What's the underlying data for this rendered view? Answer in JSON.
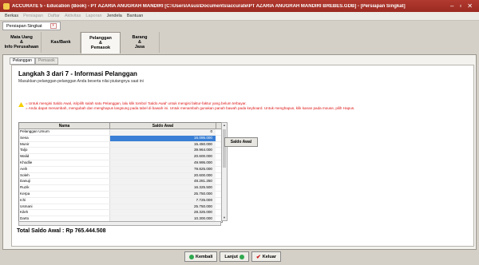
{
  "window": {
    "title": "ACCURATE 5 - Education (Book) - PT AZARIA ANUGRAH MANDIRI [C:\\Users\\Asus\\Documents\\accurate\\PT AZARIA ANUGRAH MANDIRI BREBES.GDB] - [Persiapan Singkat]",
    "minimize": "–",
    "restore": "▫",
    "close": "✕"
  },
  "menu": [
    "Berkas",
    "Persiapan",
    "Daftar",
    "Aktivitas",
    "Laporan",
    "Jendela",
    "Bantuan"
  ],
  "doc_tab": "Persiapan Singkat",
  "steps": [
    {
      "line1": "Mata Uang",
      "line2": "&",
      "line3": "Info Perusahaan"
    },
    {
      "line1": "Kas/Bank",
      "line2": "",
      "line3": ""
    },
    {
      "line1": "Pelanggan",
      "line2": "&",
      "line3": "Pemasok"
    },
    {
      "line1": "Barang",
      "line2": "&",
      "line3": "Jasa"
    }
  ],
  "subtabs": [
    "Pelanggan",
    "Pemasok"
  ],
  "heading": "Langkah 3 dari 7   - Informasi Pelanggan",
  "description": "Masukkan pelanggan-pelanggan Anda beserta nilai piutangnya saat ini",
  "warning": "= Untuk mengisi Saldo Awal, isi/pilih salah satu Pelanggan, lalu klik tombol 'Saldo Awal' untuk mengisi faktur-faktur yang belum terbayar.\n= Anda dapat menambah, mengubah dan menghapus langsung pada tabel di bawah ini. Untuk menambah gunakan panah bawah pada keyboard. Untuk menghapus, klik kanan pada mouse, pilih Hapus.",
  "grid": {
    "columns": [
      "Nama",
      "Saldo Awal"
    ],
    "rows": [
      {
        "name": "Pelanggan Umum",
        "value": "0"
      },
      {
        "name": "Sena",
        "value": "16.095.000"
      },
      {
        "name": "Munir",
        "value": "15.450.000"
      },
      {
        "name": "Taljo",
        "value": "39.964.000"
      },
      {
        "name": "Walid",
        "value": "20.600.000"
      },
      {
        "name": "Khodlie",
        "value": "49.995.000"
      },
      {
        "name": "Aeih",
        "value": "79.825.000"
      },
      {
        "name": "Soleh",
        "value": "20.600.000"
      },
      {
        "name": "Danuji",
        "value": "48.281.250"
      },
      {
        "name": "Ruzik",
        "value": "16.325.500"
      },
      {
        "name": "Kerpa",
        "value": "25.750.000"
      },
      {
        "name": "Ichi",
        "value": "7.725.000"
      },
      {
        "name": "Usmani",
        "value": "25.750.000"
      },
      {
        "name": "Kileh",
        "value": "28.325.000"
      },
      {
        "name": "Darto",
        "value": "10.300.000"
      },
      {
        "name": "Basir",
        "value": "15.450.000"
      },
      {
        "name": "",
        "value": ""
      }
    ]
  },
  "saldo_button": "Saldo Awal",
  "total": "Total Saldo Awal : Rp 765.444.508",
  "nav": {
    "back": "Kembali",
    "next": "Lanjut",
    "exit": "Keluar"
  }
}
